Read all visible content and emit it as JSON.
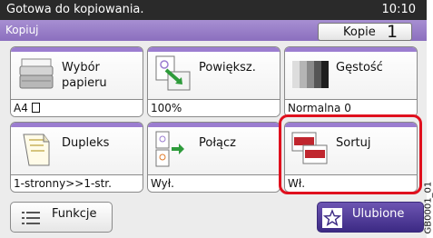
{
  "status": {
    "message": "Gotowa do kopiowania.",
    "time": "10:10"
  },
  "header": {
    "title": "Kopiuj",
    "copies_label": "Kopie",
    "copies_value": "1"
  },
  "tiles": [
    {
      "name": "paper",
      "label": "Wybór papieru",
      "value": "A4",
      "value_icon": "portrait-page-icon"
    },
    {
      "name": "zoom",
      "label": "Powiększ.",
      "value": "100%"
    },
    {
      "name": "density",
      "label": "Gęstość",
      "value": "Normalna 0"
    },
    {
      "name": "duplex",
      "label": "Dupleks",
      "value": "1-stronny>>1-str."
    },
    {
      "name": "combine",
      "label": "Połącz",
      "value": "Wył."
    },
    {
      "name": "collate",
      "label": "Sortuj",
      "value": "Wł."
    }
  ],
  "footer": {
    "functions_label": "Funkcje",
    "favorites_label": "Ulubione"
  },
  "side_code": "GB0001_01",
  "colors": {
    "accent": "#9b7dd0",
    "highlight": "#e0101e",
    "favorites": "#4a3690"
  }
}
